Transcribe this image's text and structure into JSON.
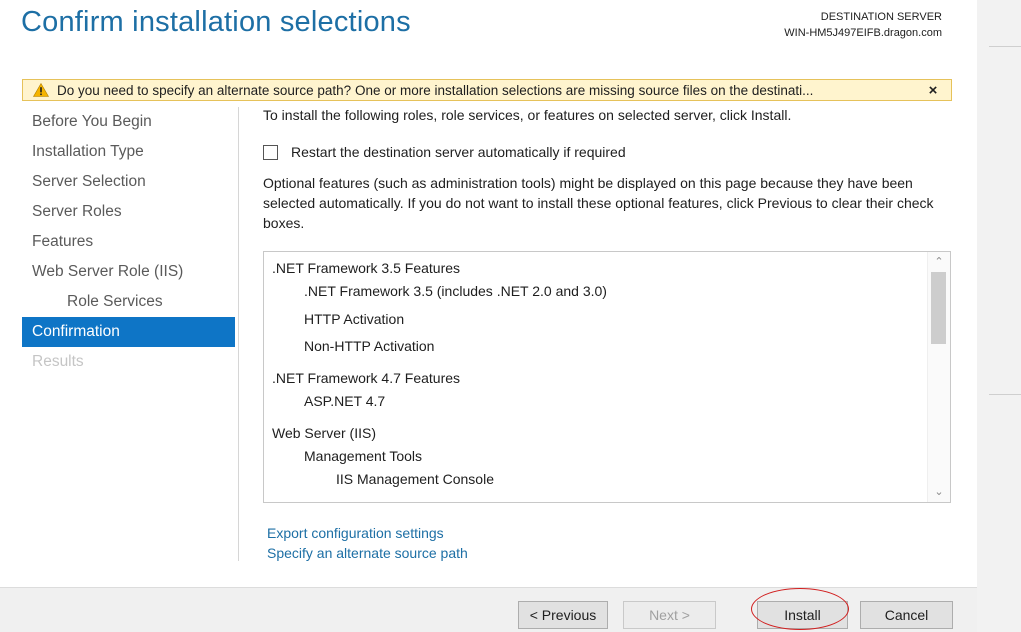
{
  "header": {
    "title": "Confirm installation selections",
    "destination_label": "DESTINATION SERVER",
    "destination_server": "WIN-HM5J497EIFB.dragon.com"
  },
  "warning": {
    "icon": "warning-icon",
    "text": "Do you need to specify an alternate source path? One or more installation selections are missing source files on the destinati...",
    "close_label": "×"
  },
  "sidebar": {
    "items": [
      {
        "label": "Before You Begin"
      },
      {
        "label": "Installation Type"
      },
      {
        "label": "Server Selection"
      },
      {
        "label": "Server Roles"
      },
      {
        "label": "Features"
      },
      {
        "label": "Web Server Role (IIS)"
      },
      {
        "label": "Role Services"
      },
      {
        "label": "Confirmation"
      },
      {
        "label": "Results"
      }
    ]
  },
  "main": {
    "intro": "To install the following roles, role services, or features on selected server, click Install.",
    "restart_label": "Restart the destination server automatically if required",
    "restart_checked": false,
    "optional_text": "Optional features (such as administration tools) might be displayed on this page because they have been selected automatically. If you do not want to install these optional features, click Previous to clear their check boxes.",
    "features": [
      {
        "label": ".NET Framework 3.5 Features"
      },
      {
        "label": ".NET Framework 3.5 (includes .NET 2.0 and 3.0)"
      },
      {
        "label": "HTTP Activation"
      },
      {
        "label": "Non-HTTP Activation"
      },
      {
        "label": ".NET Framework 4.7 Features"
      },
      {
        "label": "ASP.NET 4.7"
      },
      {
        "label": "Web Server (IIS)"
      },
      {
        "label": "Management Tools"
      },
      {
        "label": "IIS Management Console"
      }
    ],
    "links": {
      "export": "Export configuration settings",
      "alternate_source": "Specify an alternate source path"
    }
  },
  "footer": {
    "previous": "< Previous",
    "next": "Next >",
    "install": "Install",
    "cancel": "Cancel"
  },
  "colors": {
    "title": "#1d6fa5",
    "accent": "#0e75c6",
    "warning_bg": "#fff4ce",
    "highlight": "#d11f1f"
  }
}
